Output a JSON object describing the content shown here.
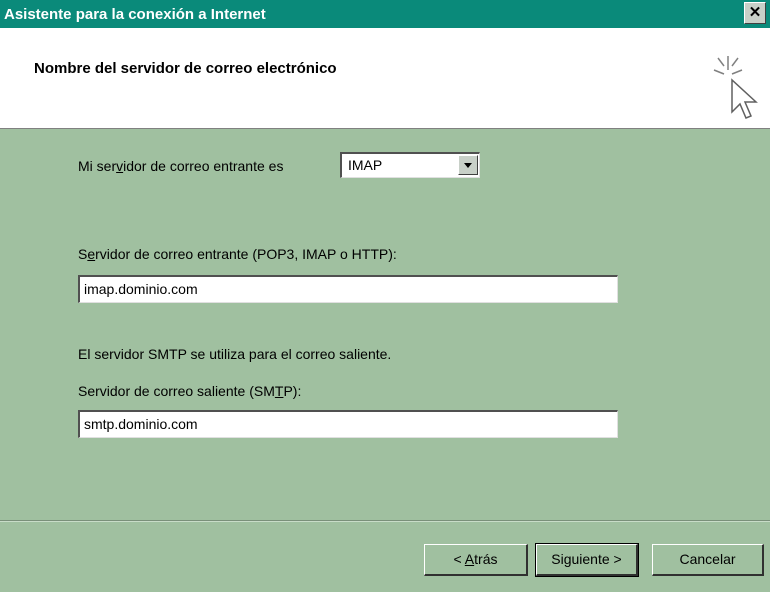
{
  "window": {
    "title": "Asistente para la conexión a Internet",
    "close_glyph": "✕"
  },
  "header": {
    "title": "Nombre del servidor de correo electrónico",
    "icon": "wizard-cursor-icon"
  },
  "incoming_type": {
    "label_pre": "Mi ser",
    "label_u": "v",
    "label_post": "idor de correo entrante es",
    "value": "IMAP"
  },
  "incoming_server": {
    "label_pre": "S",
    "label_u": "e",
    "label_post": "rvidor de correo entrante (POP3, IMAP o HTTP):",
    "value": "imap.dominio.com"
  },
  "smtp_note": "El servidor SMTP se utiliza para el correo saliente.",
  "outgoing_server": {
    "label_pre": "Servidor de correo saliente (SM",
    "label_u": "T",
    "label_post": "P):",
    "value": "smtp.dominio.com"
  },
  "buttons": {
    "back_pre": "< ",
    "back_u": "A",
    "back_post": "trás",
    "next": "Siguiente >",
    "cancel": "Cancelar"
  }
}
